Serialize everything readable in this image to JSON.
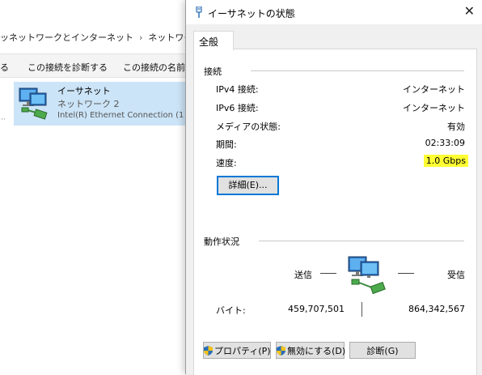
{
  "explorer": {
    "breadcrumb": [
      "ネットワークとインターネット",
      "ネットワーク接続"
    ],
    "breadcrumb_prefix": "ッ",
    "commands": [
      "る",
      "この接続を診断する",
      "この接続の名前を"
    ],
    "network": {
      "name": "イーサネット",
      "network_name": "ネットワーク 2",
      "adapter": "Intel(R) Ethernet Connection (1"
    }
  },
  "dialog": {
    "title": "イーサネットの状態",
    "close_glyph": "✕",
    "tab": "全般",
    "connection": {
      "heading": "接続",
      "rows": [
        {
          "label": "IPv4 接続:",
          "value": "インターネット"
        },
        {
          "label": "IPv6 接続:",
          "value": "インターネット"
        },
        {
          "label": "メディアの状態:",
          "value": "有効"
        },
        {
          "label": "期間:",
          "value": "02:33:09"
        },
        {
          "label": "速度:",
          "value": "1.0 Gbps"
        }
      ],
      "details_button": "詳細(E)..."
    },
    "activity": {
      "heading": "動作状況",
      "sent_label": "送信",
      "received_label": "受信",
      "bytes_label": "バイト:",
      "bytes_sent": "459,707,501",
      "bytes_received": "864,342,567"
    },
    "buttons": {
      "properties": "プロパティ(P)",
      "disable": "無効にする(D)",
      "diagnose": "診断(G)"
    }
  },
  "colors": {
    "highlight": "#ffff33",
    "selection": "#cce4f7",
    "focus_border": "#0078d7"
  }
}
